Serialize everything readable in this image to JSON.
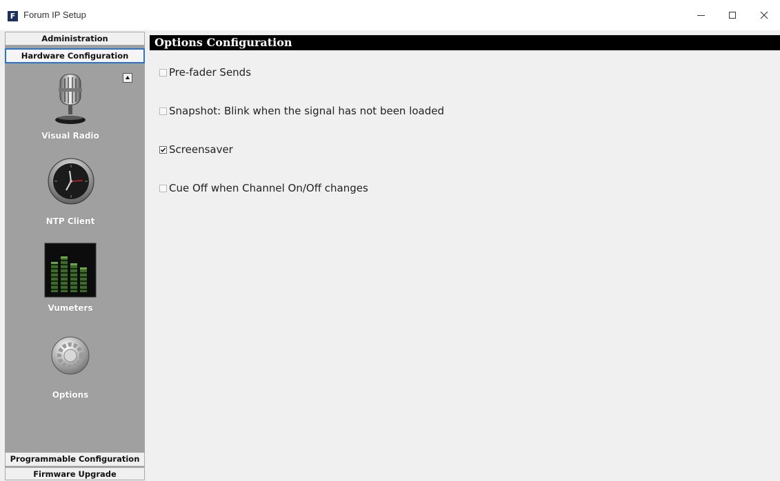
{
  "window": {
    "icon_letter": "F",
    "title": "Forum IP Setup"
  },
  "sidebar": {
    "sections": {
      "administration": "Administration",
      "hardware_configuration": "Hardware Configuration",
      "programmable_configuration": "Programmable Configuration",
      "firmware_upgrade": "Firmware Upgrade"
    },
    "items": [
      {
        "label": "Visual Radio",
        "icon": "microphone-icon"
      },
      {
        "label": "NTP Client",
        "icon": "clock-icon"
      },
      {
        "label": "Vumeters",
        "icon": "vumeter-icon"
      },
      {
        "label": "Options",
        "icon": "gear-icon"
      }
    ]
  },
  "main": {
    "header": "Options Configuration",
    "options": [
      {
        "label": "Pre-fader Sends",
        "checked": false
      },
      {
        "label": "Snapshot: Blink when the signal has not been loaded",
        "checked": false
      },
      {
        "label": "Screensaver",
        "checked": true
      },
      {
        "label": "Cue Off when Channel On/Off changes",
        "checked": false
      }
    ]
  },
  "colors": {
    "sidebar_bg": "#a0a0a0",
    "header_bg": "#000000",
    "selected_border": "#2b73c4"
  }
}
